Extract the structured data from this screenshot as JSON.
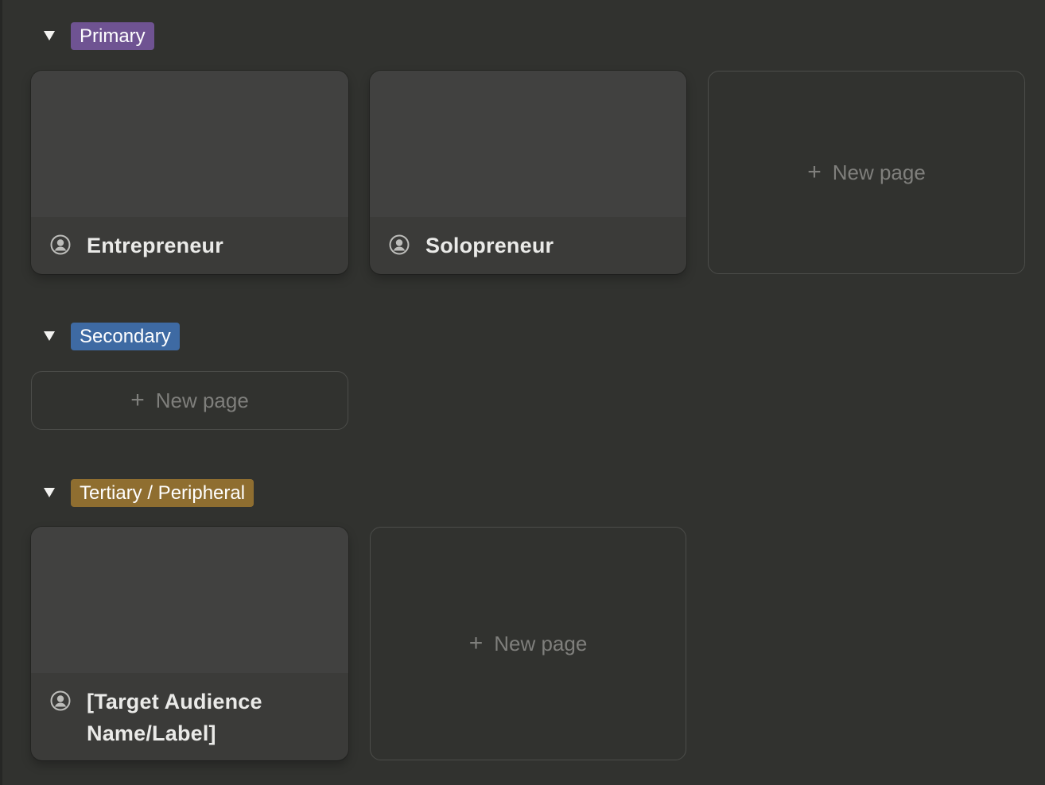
{
  "groups": [
    {
      "tag": "Primary",
      "tag_color": "#6f5392",
      "cards": [
        {
          "title": "Entrepreneur",
          "icon": "user-circle-icon"
        },
        {
          "title": "Solopreneur",
          "icon": "user-circle-icon"
        }
      ],
      "new_page_label": "New page"
    },
    {
      "tag": "Secondary",
      "tag_color": "#3e6aa3",
      "cards": [],
      "new_page_label": "New page"
    },
    {
      "tag": "Tertiary / Peripheral",
      "tag_color": "#8f6e30",
      "cards": [
        {
          "title": "[Target Audience Name/Label]",
          "icon": "user-circle-icon"
        }
      ],
      "new_page_label": "New page"
    }
  ],
  "icons": {
    "toggle": "triangle-down-icon",
    "plus": "plus-icon",
    "card": "user-circle-icon"
  }
}
